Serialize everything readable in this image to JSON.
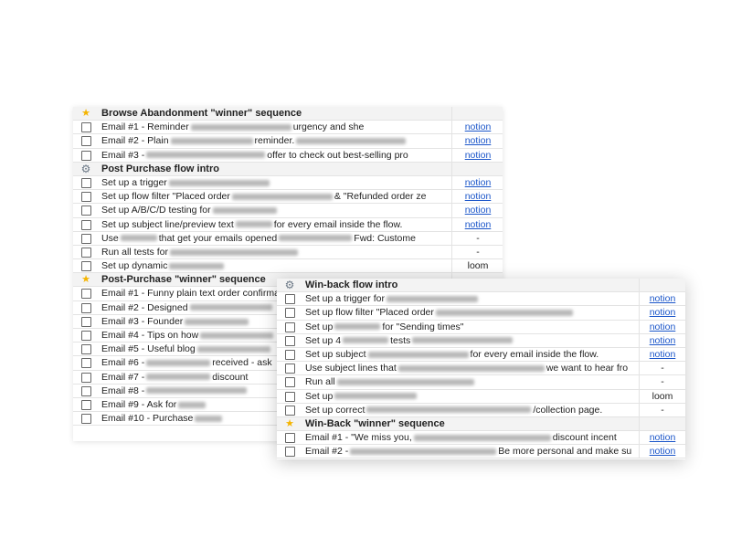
{
  "back_sheet": {
    "rows": [
      {
        "type": "section",
        "icon": "star-icon",
        "label": "Browse Abandonment \"winner\" sequence",
        "right": ""
      },
      {
        "type": "task",
        "before": "Email #1 - Reminder",
        "blur": 110,
        "after": "urgency and she",
        "right": "notion",
        "link": true
      },
      {
        "type": "task",
        "before": "Email #2 - Plain",
        "blur": 90,
        "after": "reminder.",
        "blur2": 120,
        "right": "notion",
        "link": true
      },
      {
        "type": "task",
        "before": "Email #3 -",
        "blur": 130,
        "after": "offer to check out best-selling pro",
        "right": "notion",
        "link": true
      },
      {
        "type": "section",
        "icon": "gear-icon",
        "label": "Post Purchase flow intro",
        "right": ""
      },
      {
        "type": "task",
        "before": "Set up a trigger",
        "blur": 110,
        "after": "",
        "right": "notion",
        "link": true
      },
      {
        "type": "task",
        "before": "Set up flow filter \"Placed order",
        "blur": 110,
        "after": "& \"Refunded order ze",
        "right": "notion",
        "link": true
      },
      {
        "type": "task",
        "before": "Set up A/B/C/D testing for",
        "blur": 70,
        "after": "",
        "right": "notion",
        "link": true
      },
      {
        "type": "task",
        "before": "Set up subject line/preview text",
        "blur": 40,
        "after": "for every email inside the flow.",
        "right": "notion",
        "link": true
      },
      {
        "type": "task",
        "before": "Use",
        "blur": 40,
        "after": "that get your emails opened",
        "blur2": 80,
        "after2": "Fwd: Custome",
        "right": "-",
        "link": false
      },
      {
        "type": "task",
        "before": "Run all tests for",
        "blur": 140,
        "after": "",
        "right": "-",
        "link": false
      },
      {
        "type": "task",
        "before": "Set up dynamic",
        "blur": 60,
        "after": "",
        "right": "loom",
        "link": false
      },
      {
        "type": "section",
        "icon": "star-icon",
        "label": "Post-Purchase \"winner\" sequence",
        "right": ""
      },
      {
        "type": "task",
        "before": "Email #1 - Funny plain text order confirmatio",
        "blur": 0,
        "after": "",
        "right": "",
        "link": false
      },
      {
        "type": "task",
        "before": "Email #2 - Designed",
        "blur": 90,
        "after": "",
        "right": "",
        "link": false
      },
      {
        "type": "task",
        "before": "Email #3 - Founder",
        "blur": 70,
        "after": "",
        "right": "",
        "link": false
      },
      {
        "type": "task",
        "before": "Email #4 - Tips on how",
        "blur": 80,
        "after": "",
        "right": "",
        "link": false
      },
      {
        "type": "task",
        "before": "Email #5 - Useful blog",
        "blur": 80,
        "after": "",
        "right": "",
        "link": false
      },
      {
        "type": "task",
        "before": "Email #6 -",
        "blur": 70,
        "after": "received - ask",
        "right": "",
        "link": false
      },
      {
        "type": "task",
        "before": "Email #7 -",
        "blur": 70,
        "after": "discount",
        "right": "",
        "link": false
      },
      {
        "type": "task",
        "before": "Email #8 -",
        "blur": 110,
        "after": "",
        "right": "",
        "link": false
      },
      {
        "type": "task",
        "before": "Email #9 - Ask for",
        "blur": 30,
        "after": "",
        "right": "",
        "link": false
      },
      {
        "type": "task",
        "before": "Email #10 - Purchase",
        "blur": 30,
        "after": "",
        "right": "",
        "link": false
      }
    ]
  },
  "front_sheet": {
    "rows": [
      {
        "type": "section",
        "icon": "gear-icon",
        "label": "Win-back flow intro",
        "right": ""
      },
      {
        "type": "task",
        "before": "Set up a trigger for",
        "blur": 100,
        "after": "",
        "right": "notion",
        "link": true
      },
      {
        "type": "task",
        "before": "Set up flow filter \"Placed order",
        "blur": 150,
        "after": "",
        "right": "notion",
        "link": true
      },
      {
        "type": "task",
        "before": "Set up",
        "blur": 50,
        "after": "for \"Sending times\"",
        "right": "notion",
        "link": true
      },
      {
        "type": "task",
        "before": "Set up 4",
        "blur": 50,
        "after": "tests",
        "blur2": 110,
        "right": "notion",
        "link": true
      },
      {
        "type": "task",
        "before": "Set up subject",
        "blur": 110,
        "after": "for every email inside the flow.",
        "right": "notion",
        "link": true
      },
      {
        "type": "task",
        "before": "Use subject lines that",
        "blur": 160,
        "after": "we want to hear fro",
        "right": "-",
        "link": false
      },
      {
        "type": "task",
        "before": "Run all",
        "blur": 150,
        "after": "",
        "right": "-",
        "link": false
      },
      {
        "type": "task",
        "before": "Set up",
        "blur": 90,
        "after": "",
        "right": "loom",
        "link": false
      },
      {
        "type": "task",
        "before": "Set up correct",
        "blur": 180,
        "after": "/collection page.",
        "right": "-",
        "link": false
      },
      {
        "type": "section",
        "icon": "star-icon",
        "label": "Win-Back \"winner\" sequence",
        "right": ""
      },
      {
        "type": "task",
        "before": "Email #1 - \"We miss you,",
        "blur": 150,
        "after": "discount incent",
        "right": "notion",
        "link": true
      },
      {
        "type": "task",
        "before": "Email #2 -",
        "blur": 160,
        "after": "Be more personal and make su",
        "right": "notion",
        "link": true
      }
    ]
  },
  "icons": {
    "star-icon": "★",
    "gear-icon": "⚙"
  }
}
